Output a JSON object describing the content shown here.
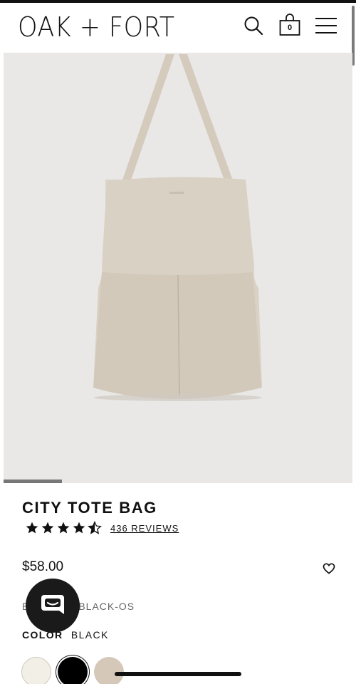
{
  "header": {
    "logo": "OAK + FORT",
    "cart_count": "0",
    "icons": [
      "search-icon",
      "shopping-bag-icon",
      "hamburger-menu-icon"
    ]
  },
  "gallery": {
    "slide_progress": 0.17
  },
  "product": {
    "title": "CITY TOTE BAG",
    "rating": 4.5,
    "reviews_label": "436 REVIEWS",
    "price": "$58.00",
    "sku_prefix": "B",
    "sku_suffix": "BLACK-OS",
    "color_label": "COLOR",
    "color_value": "BLACK",
    "swatches": [
      {
        "name": "cream",
        "color": "#f2efe6"
      },
      {
        "name": "black",
        "color": "#000000",
        "selected": true
      },
      {
        "name": "taupe",
        "color": "#d6c8b9"
      }
    ]
  },
  "colors": {
    "text": "#111111",
    "gallery_bg": "#e9e8e6",
    "bag": "#d9d1c4",
    "chat_button": "#1a1a1a"
  }
}
